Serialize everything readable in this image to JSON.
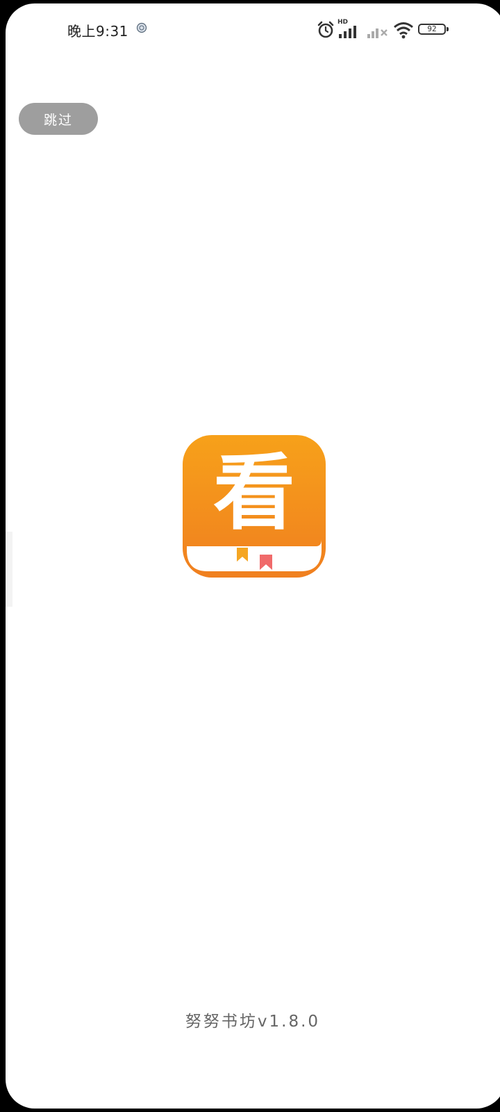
{
  "status_bar": {
    "time": "晚上9:31",
    "battery_level": "92",
    "network_label": "HD",
    "icons": [
      "notification-icon",
      "alarm-icon",
      "hd-signal-icon",
      "signal-no-service-icon",
      "wifi-icon",
      "battery-icon"
    ]
  },
  "skip_button": {
    "label": "跳过"
  },
  "logo": {
    "character": "看",
    "gradient_top": "#f7a11a",
    "gradient_bottom": "#f07f1f",
    "bookmark_left_color": "#f5a623",
    "bookmark_right_color": "#f06a6a"
  },
  "footer": {
    "app_version": "努努书坊v1.8.0"
  }
}
